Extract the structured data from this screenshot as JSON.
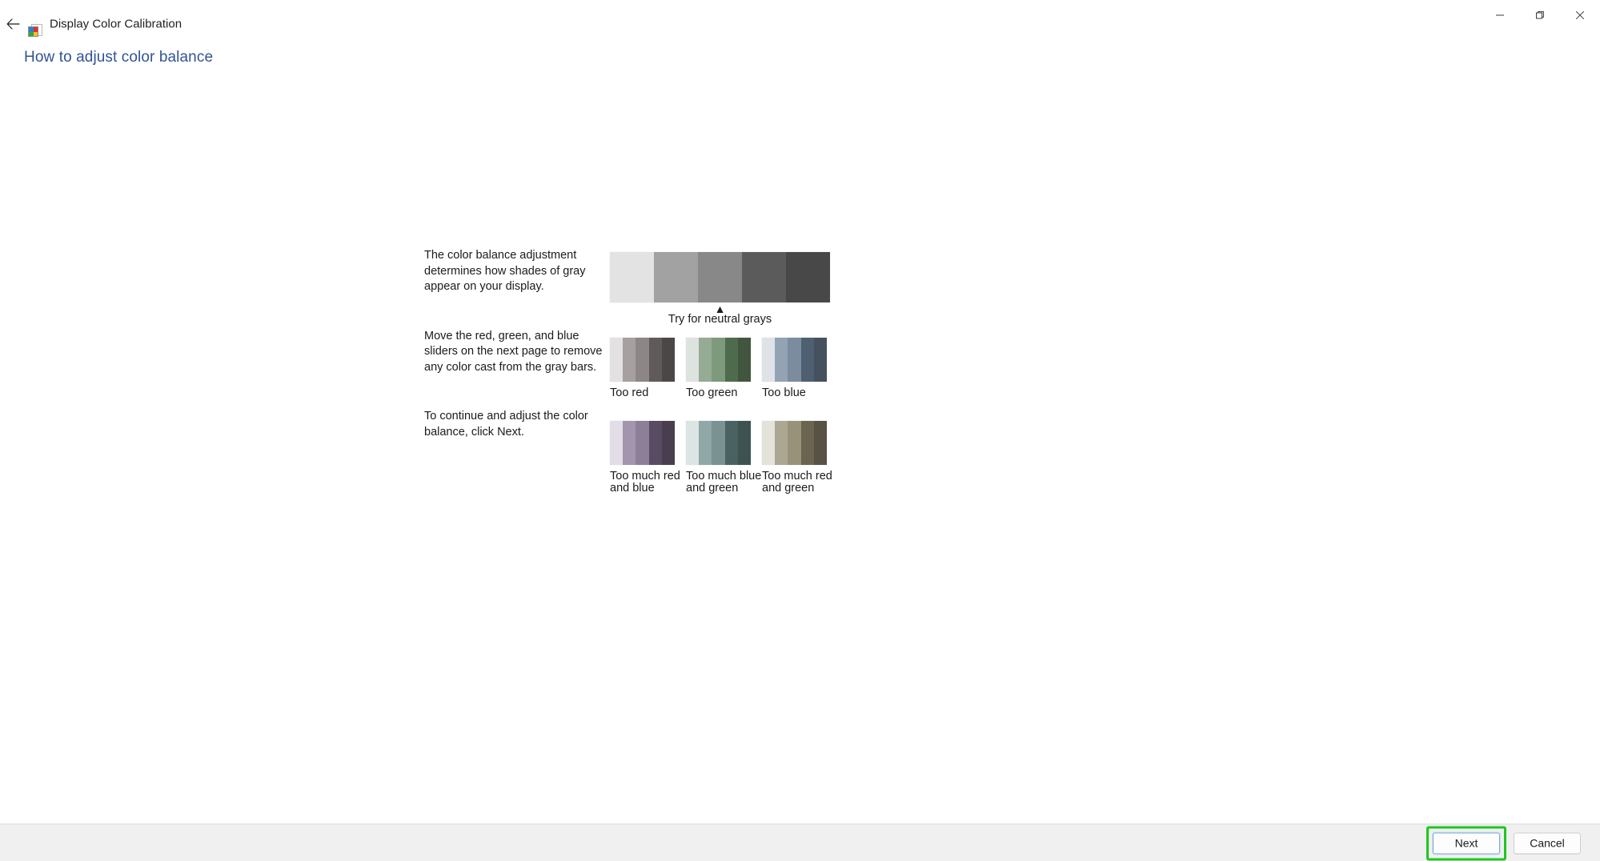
{
  "window": {
    "title": "Display Color Calibration",
    "back_icon": "back-arrow-icon",
    "app_icon": "display-color-calibration-icon",
    "controls": {
      "minimize": "minimize-icon",
      "maximize": "maximize-restore-icon",
      "close": "close-icon"
    }
  },
  "page": {
    "heading": "How to adjust color balance",
    "paragraphs": [
      "The color balance adjustment determines how shades of gray appear on your display.",
      "Move the red, green, and blue sliders on the next page to remove any color cast from the gray bars.",
      "To continue and adjust the color balance, click Next."
    ]
  },
  "samples": {
    "caret_glyph": "▲",
    "caret_icon": "up-caret-marker-icon",
    "neutral_label": "Try for neutral grays",
    "main_strip": {
      "name": "neutral-gray-reference-strip",
      "bands": [
        "#e3e3e3",
        "#a2a2a2",
        "#888888",
        "#5b5b5b",
        "#484848"
      ]
    },
    "examples": [
      {
        "label": "Too red",
        "name": "swatch-too-red",
        "bands": [
          "#e4e1e2",
          "#a6a0a1",
          "#8d8687",
          "#605a5a",
          "#4c4747"
        ]
      },
      {
        "label": "Too green",
        "name": "swatch-too-green",
        "bands": [
          "#dde3de",
          "#96ab94",
          "#7d9a7c",
          "#4e6b4e",
          "#42563f"
        ]
      },
      {
        "label": "Too blue",
        "name": "swatch-too-blue",
        "bands": [
          "#dfe3e8",
          "#93a3b4",
          "#7b8c9f",
          "#4f5f72",
          "#46515f"
        ]
      },
      {
        "label": "Too much red and blue",
        "name": "swatch-too-much-red-and-blue",
        "bands": [
          "#e2dde6",
          "#a395ad",
          "#8d7f98",
          "#584c63",
          "#483e50"
        ]
      },
      {
        "label": "Too much blue and green",
        "name": "swatch-too-much-blue-and-green",
        "bands": [
          "#dde4e4",
          "#91a8a8",
          "#7a9292",
          "#4b6262",
          "#3f5252"
        ]
      },
      {
        "label": "Too much red and green",
        "name": "swatch-too-much-red-and-green",
        "bands": [
          "#e4e3da",
          "#aba793",
          "#979279",
          "#6a6450",
          "#575243"
        ]
      }
    ]
  },
  "footer": {
    "next_label": "Next",
    "cancel_label": "Cancel"
  },
  "colors": {
    "heading": "#2f5496",
    "highlight": "#1ec81e",
    "footer_bg": "#f0f0f0"
  }
}
